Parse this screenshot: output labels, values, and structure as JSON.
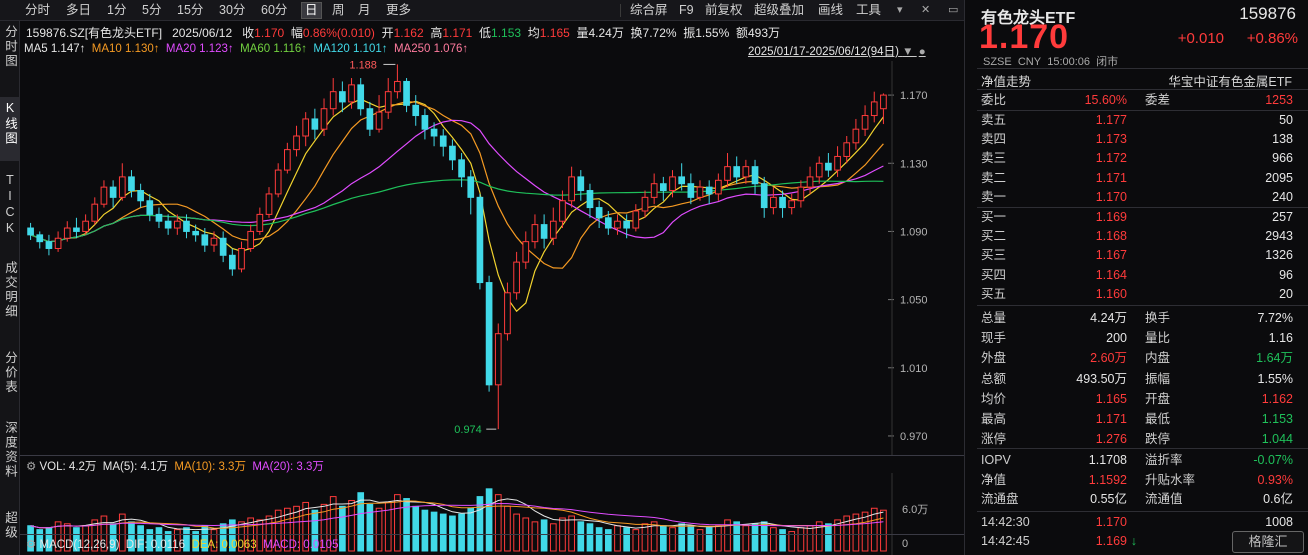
{
  "toolbar": {
    "periods": [
      "分时",
      "多日",
      "1分",
      "5分",
      "15分",
      "30分",
      "60分",
      "日",
      "周",
      "月",
      "更多"
    ],
    "active_period": "日",
    "tools": [
      "综合屏",
      "F9",
      "前复权",
      "超级叠加",
      "画线",
      "工具"
    ]
  },
  "side_tabs": [
    "分时图",
    "K线图",
    "TICK",
    "成交明细",
    "分价表",
    "深度资料",
    "超级"
  ],
  "info": {
    "code_name": "159876.SZ[有色龙头ETF]",
    "date": "2025/06/12",
    "close_label": "收",
    "close": "1.170",
    "change_label": "幅",
    "change": "0.86%(0.010)",
    "open_label": "开",
    "open": "1.162",
    "high_label": "高",
    "high": "1.171",
    "low_label": "低",
    "low": "1.153",
    "avg_label": "均",
    "avg": "1.165",
    "vol_label": "量",
    "vol": "4.24万",
    "turnover_label": "换",
    "turnover": "7.72%",
    "amp_label": "振",
    "amp": "1.55%",
    "amount_label": "额",
    "amount": "493万"
  },
  "ma_line": {
    "ma5": "MA5 1.147↑",
    "ma10": "MA10 1.130↑",
    "ma20": "MA20 1.123↑",
    "ma60": "MA60 1.116↑",
    "ma120": "MA120 1.101↑",
    "ma250": "MA250 1.076↑",
    "range": "2025/01/17-2025/06/12(94日)"
  },
  "price_axis": [
    "1.170",
    "1.130",
    "1.090",
    "1.050",
    "1.010",
    "0.970"
  ],
  "annotations": {
    "high_mark": "1.188",
    "low_mark": "0.974"
  },
  "vol_line": {
    "vol": "VOL: 4.2万",
    "ma5": "MA(5): 4.1万",
    "ma10": "MA(10): 3.3万",
    "ma20": "MA(20): 3.3万",
    "axis_top": "6.0万",
    "axis_zero": "0"
  },
  "macd_line": {
    "name": "MACD(12,26,9)",
    "dif": "DIF: 0.0116",
    "dea": "DEA: 0.0063",
    "macd": "MACD: 0.0105"
  },
  "colors": {
    "up": "#ff3b3b",
    "down": "#41d9e8",
    "ma5": "#f2d32e",
    "ma10": "#f59a23",
    "ma20": "#e04cff",
    "ma60": "#1fc05a",
    "ma120": "#41d9e8",
    "ma250": "#ff7b9e"
  },
  "chart_data": {
    "type": "candlestick",
    "ylim": [
      0.96,
      1.19
    ],
    "candles": [
      [
        1.092,
        1.088,
        1.095,
        1.085
      ],
      [
        1.088,
        1.084,
        1.09,
        1.08
      ],
      [
        1.084,
        1.08,
        1.088,
        1.076
      ],
      [
        1.08,
        1.086,
        1.09,
        1.078
      ],
      [
        1.086,
        1.092,
        1.096,
        1.084
      ],
      [
        1.092,
        1.09,
        1.098,
        1.086
      ],
      [
        1.09,
        1.096,
        1.1,
        1.088
      ],
      [
        1.096,
        1.106,
        1.11,
        1.094
      ],
      [
        1.106,
        1.116,
        1.12,
        1.104
      ],
      [
        1.116,
        1.11,
        1.12,
        1.104
      ],
      [
        1.11,
        1.122,
        1.13,
        1.108
      ],
      [
        1.122,
        1.114,
        1.126,
        1.11
      ],
      [
        1.114,
        1.108,
        1.118,
        1.104
      ],
      [
        1.108,
        1.1,
        1.112,
        1.096
      ],
      [
        1.1,
        1.096,
        1.104,
        1.092
      ],
      [
        1.096,
        1.092,
        1.1,
        1.088
      ],
      [
        1.092,
        1.096,
        1.1,
        1.088
      ],
      [
        1.096,
        1.09,
        1.1,
        1.086
      ],
      [
        1.09,
        1.088,
        1.094,
        1.084
      ],
      [
        1.088,
        1.082,
        1.092,
        1.078
      ],
      [
        1.082,
        1.086,
        1.09,
        1.078
      ],
      [
        1.086,
        1.076,
        1.09,
        1.072
      ],
      [
        1.076,
        1.068,
        1.08,
        1.064
      ],
      [
        1.068,
        1.08,
        1.084,
        1.066
      ],
      [
        1.08,
        1.09,
        1.094,
        1.078
      ],
      [
        1.09,
        1.1,
        1.104,
        1.088
      ],
      [
        1.1,
        1.112,
        1.116,
        1.098
      ],
      [
        1.112,
        1.126,
        1.13,
        1.11
      ],
      [
        1.126,
        1.138,
        1.142,
        1.124
      ],
      [
        1.138,
        1.146,
        1.152,
        1.134
      ],
      [
        1.146,
        1.156,
        1.16,
        1.14
      ],
      [
        1.156,
        1.15,
        1.162,
        1.144
      ],
      [
        1.15,
        1.162,
        1.168,
        1.146
      ],
      [
        1.162,
        1.172,
        1.18,
        1.158
      ],
      [
        1.172,
        1.166,
        1.178,
        1.16
      ],
      [
        1.166,
        1.176,
        1.18,
        1.162
      ],
      [
        1.176,
        1.162,
        1.18,
        1.158
      ],
      [
        1.162,
        1.15,
        1.166,
        1.146
      ],
      [
        1.15,
        1.16,
        1.17,
        1.148
      ],
      [
        1.16,
        1.172,
        1.18,
        1.156
      ],
      [
        1.172,
        1.178,
        1.188,
        1.168
      ],
      [
        1.178,
        1.164,
        1.18,
        1.16
      ],
      [
        1.164,
        1.158,
        1.17,
        1.152
      ],
      [
        1.158,
        1.15,
        1.162,
        1.144
      ],
      [
        1.15,
        1.146,
        1.154,
        1.14
      ],
      [
        1.146,
        1.14,
        1.15,
        1.134
      ],
      [
        1.14,
        1.132,
        1.144,
        1.126
      ],
      [
        1.132,
        1.122,
        1.136,
        1.116
      ],
      [
        1.122,
        1.11,
        1.126,
        1.1
      ],
      [
        1.11,
        1.06,
        1.112,
        1.056
      ],
      [
        1.06,
        1.0,
        1.064,
        0.996
      ],
      [
        1.0,
        1.03,
        1.036,
        0.974
      ],
      [
        1.03,
        1.054,
        1.06,
        1.026
      ],
      [
        1.054,
        1.072,
        1.078,
        1.05
      ],
      [
        1.072,
        1.084,
        1.09,
        1.068
      ],
      [
        1.084,
        1.094,
        1.1,
        1.08
      ],
      [
        1.094,
        1.086,
        1.1,
        1.08
      ],
      [
        1.086,
        1.096,
        1.104,
        1.082
      ],
      [
        1.096,
        1.108,
        1.114,
        1.092
      ],
      [
        1.108,
        1.122,
        1.128,
        1.104
      ],
      [
        1.122,
        1.114,
        1.126,
        1.108
      ],
      [
        1.114,
        1.104,
        1.118,
        1.098
      ],
      [
        1.104,
        1.098,
        1.108,
        1.092
      ],
      [
        1.098,
        1.092,
        1.102,
        1.088
      ],
      [
        1.092,
        1.096,
        1.1,
        1.088
      ],
      [
        1.096,
        1.092,
        1.1,
        1.086
      ],
      [
        1.092,
        1.102,
        1.106,
        1.09
      ],
      [
        1.102,
        1.11,
        1.114,
        1.098
      ],
      [
        1.11,
        1.118,
        1.124,
        1.106
      ],
      [
        1.118,
        1.114,
        1.122,
        1.108
      ],
      [
        1.114,
        1.122,
        1.126,
        1.11
      ],
      [
        1.122,
        1.118,
        1.13,
        1.114
      ],
      [
        1.118,
        1.11,
        1.124,
        1.106
      ],
      [
        1.11,
        1.116,
        1.12,
        1.108
      ],
      [
        1.116,
        1.112,
        1.12,
        1.106
      ],
      [
        1.112,
        1.12,
        1.124,
        1.108
      ],
      [
        1.12,
        1.128,
        1.136,
        1.116
      ],
      [
        1.128,
        1.122,
        1.134,
        1.118
      ],
      [
        1.122,
        1.128,
        1.132,
        1.118
      ],
      [
        1.128,
        1.118,
        1.132,
        1.112
      ],
      [
        1.118,
        1.104,
        1.122,
        1.098
      ],
      [
        1.104,
        1.11,
        1.116,
        1.1
      ],
      [
        1.11,
        1.104,
        1.114,
        1.098
      ],
      [
        1.104,
        1.108,
        1.112,
        1.1
      ],
      [
        1.108,
        1.116,
        1.12,
        1.104
      ],
      [
        1.116,
        1.122,
        1.128,
        1.112
      ],
      [
        1.122,
        1.13,
        1.134,
        1.118
      ],
      [
        1.13,
        1.126,
        1.136,
        1.122
      ],
      [
        1.126,
        1.134,
        1.14,
        1.122
      ],
      [
        1.134,
        1.142,
        1.146,
        1.13
      ],
      [
        1.142,
        1.15,
        1.156,
        1.138
      ],
      [
        1.15,
        1.158,
        1.164,
        1.146
      ],
      [
        1.158,
        1.166,
        1.172,
        1.154
      ],
      [
        1.162,
        1.17,
        1.171,
        1.153
      ]
    ],
    "volumes": [
      2.6,
      2.2,
      2.4,
      3.0,
      2.8,
      2.4,
      2.6,
      3.2,
      3.6,
      2.8,
      3.8,
      3.0,
      2.6,
      2.2,
      2.4,
      2.0,
      2.2,
      2.4,
      2.0,
      2.6,
      2.2,
      2.8,
      3.2,
      3.0,
      3.4,
      3.2,
      3.6,
      4.2,
      4.4,
      4.6,
      5.0,
      4.2,
      4.8,
      5.6,
      4.6,
      5.2,
      6.0,
      4.8,
      4.4,
      5.0,
      5.8,
      5.4,
      4.6,
      4.2,
      4.0,
      3.8,
      3.6,
      3.8,
      4.4,
      5.6,
      6.4,
      5.8,
      4.6,
      3.8,
      3.4,
      3.0,
      3.2,
      2.8,
      3.4,
      3.6,
      3.0,
      2.8,
      2.4,
      2.2,
      2.6,
      2.4,
      2.2,
      2.8,
      3.0,
      2.6,
      2.4,
      2.8,
      2.6,
      2.2,
      2.4,
      2.6,
      3.2,
      3.0,
      2.6,
      2.8,
      3.0,
      2.4,
      2.2,
      2.0,
      2.4,
      2.6,
      3.0,
      2.8,
      3.2,
      3.6,
      3.8,
      4.0,
      4.4,
      4.2
    ]
  },
  "right_panel": {
    "name": "有色龙头ETF",
    "code": "159876",
    "price": "1.170",
    "change": "+0.010",
    "change_pct": "+0.86%",
    "market": "SZSE",
    "currency": "CNY",
    "time": "15:00:06",
    "status": "闭市",
    "nav_tab": "净值走势",
    "index_name": "华宝中证有色金属ETF",
    "weibi_label": "委比",
    "weibi": "15.60%",
    "weicha_label": "委差",
    "weicha": "1253",
    "asks": [
      {
        "label": "卖五",
        "price": "1.177",
        "vol": "50"
      },
      {
        "label": "卖四",
        "price": "1.173",
        "vol": "138"
      },
      {
        "label": "卖三",
        "price": "1.172",
        "vol": "966"
      },
      {
        "label": "卖二",
        "price": "1.171",
        "vol": "2095"
      },
      {
        "label": "卖一",
        "price": "1.170",
        "vol": "240"
      }
    ],
    "bids": [
      {
        "label": "买一",
        "price": "1.169",
        "vol": "257"
      },
      {
        "label": "买二",
        "price": "1.168",
        "vol": "2943"
      },
      {
        "label": "买三",
        "price": "1.167",
        "vol": "1326"
      },
      {
        "label": "买四",
        "price": "1.164",
        "vol": "96"
      },
      {
        "label": "买五",
        "price": "1.160",
        "vol": "20"
      }
    ],
    "stats": [
      {
        "l1": "总量",
        "v1": "4.24万",
        "c1": "white",
        "l2": "换手",
        "v2": "7.72%",
        "c2": "white"
      },
      {
        "l1": "现手",
        "v1": "200",
        "c1": "white",
        "l2": "量比",
        "v2": "1.16",
        "c2": "white"
      },
      {
        "l1": "外盘",
        "v1": "2.60万",
        "c1": "red",
        "l2": "内盘",
        "v2": "1.64万",
        "c2": "green"
      },
      {
        "l1": "总额",
        "v1": "493.50万",
        "c1": "white",
        "l2": "振幅",
        "v2": "1.55%",
        "c2": "white"
      },
      {
        "l1": "均价",
        "v1": "1.165",
        "c1": "red",
        "l2": "开盘",
        "v2": "1.162",
        "c2": "red"
      },
      {
        "l1": "最高",
        "v1": "1.171",
        "c1": "red",
        "l2": "最低",
        "v2": "1.153",
        "c2": "green"
      },
      {
        "l1": "涨停",
        "v1": "1.276",
        "c1": "red",
        "l2": "跌停",
        "v2": "1.044",
        "c2": "green"
      }
    ],
    "stats2": [
      {
        "l1": "IOPV",
        "v1": "1.1708",
        "c1": "white",
        "l2": "溢折率",
        "v2": "-0.07%",
        "c2": "green"
      },
      {
        "l1": "净值",
        "v1": "1.1592",
        "c1": "red",
        "l2": "升贴水率",
        "v2": "0.93%",
        "c2": "red"
      },
      {
        "l1": "流通盘",
        "v1": "0.55亿",
        "c1": "white",
        "l2": "流通值",
        "v2": "0.6亿",
        "c2": "white"
      }
    ],
    "ticks": [
      {
        "time": "14:42:30",
        "price": "1.170",
        "vol": "1008",
        "dir": ""
      },
      {
        "time": "14:42:45",
        "price": "1.169",
        "vol": "",
        "dir": "↓"
      }
    ],
    "watermark": "格隆汇"
  }
}
